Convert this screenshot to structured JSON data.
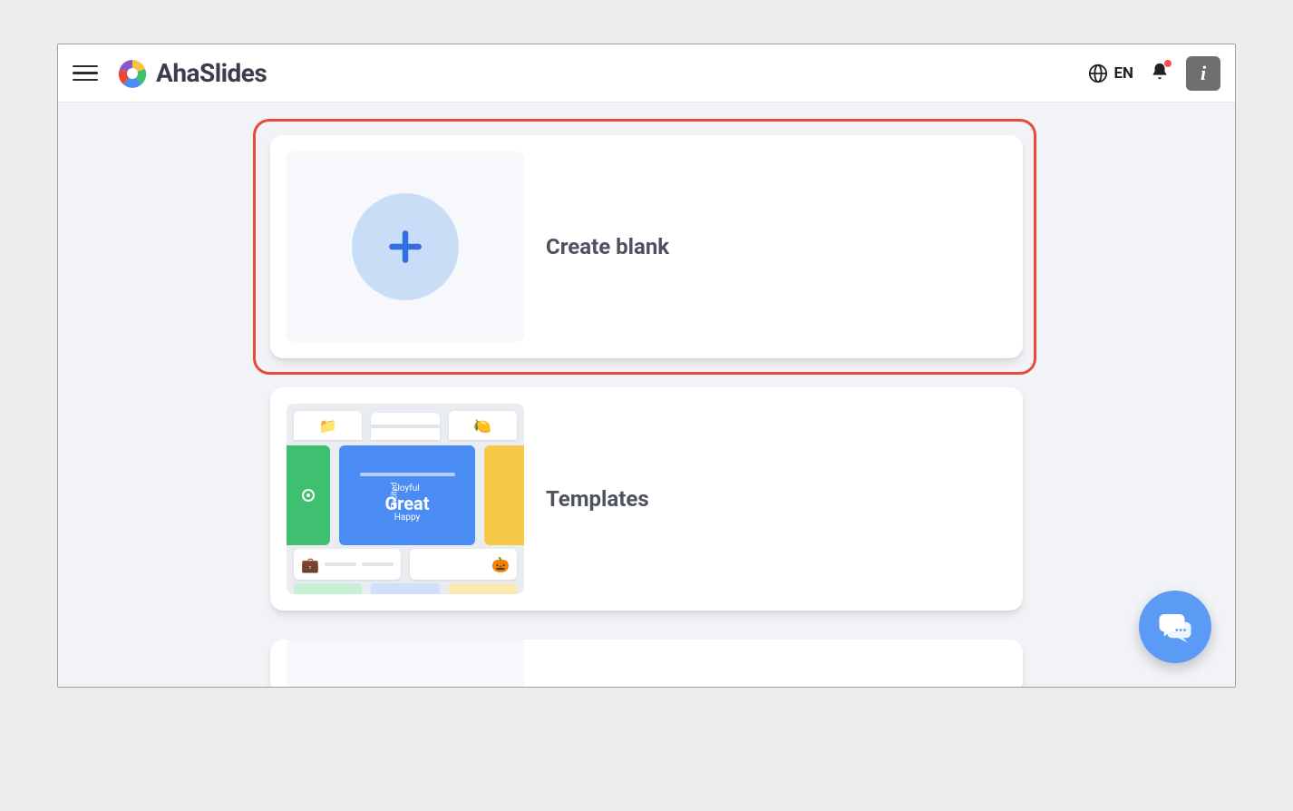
{
  "header": {
    "brand_name": "AhaSlides",
    "language_label": "EN"
  },
  "cards": {
    "create_blank_label": "Create blank",
    "templates_label": "Templates"
  },
  "template_preview": {
    "word_top": "Joyful",
    "word_big": "Great",
    "word_bottom": "Happy",
    "word_side": "Excited"
  },
  "icons": {
    "hamburger": "menu-icon",
    "globe": "globe-icon",
    "bell": "bell-icon",
    "info": "info-icon",
    "plus": "plus-icon",
    "chat": "chat-icon"
  }
}
